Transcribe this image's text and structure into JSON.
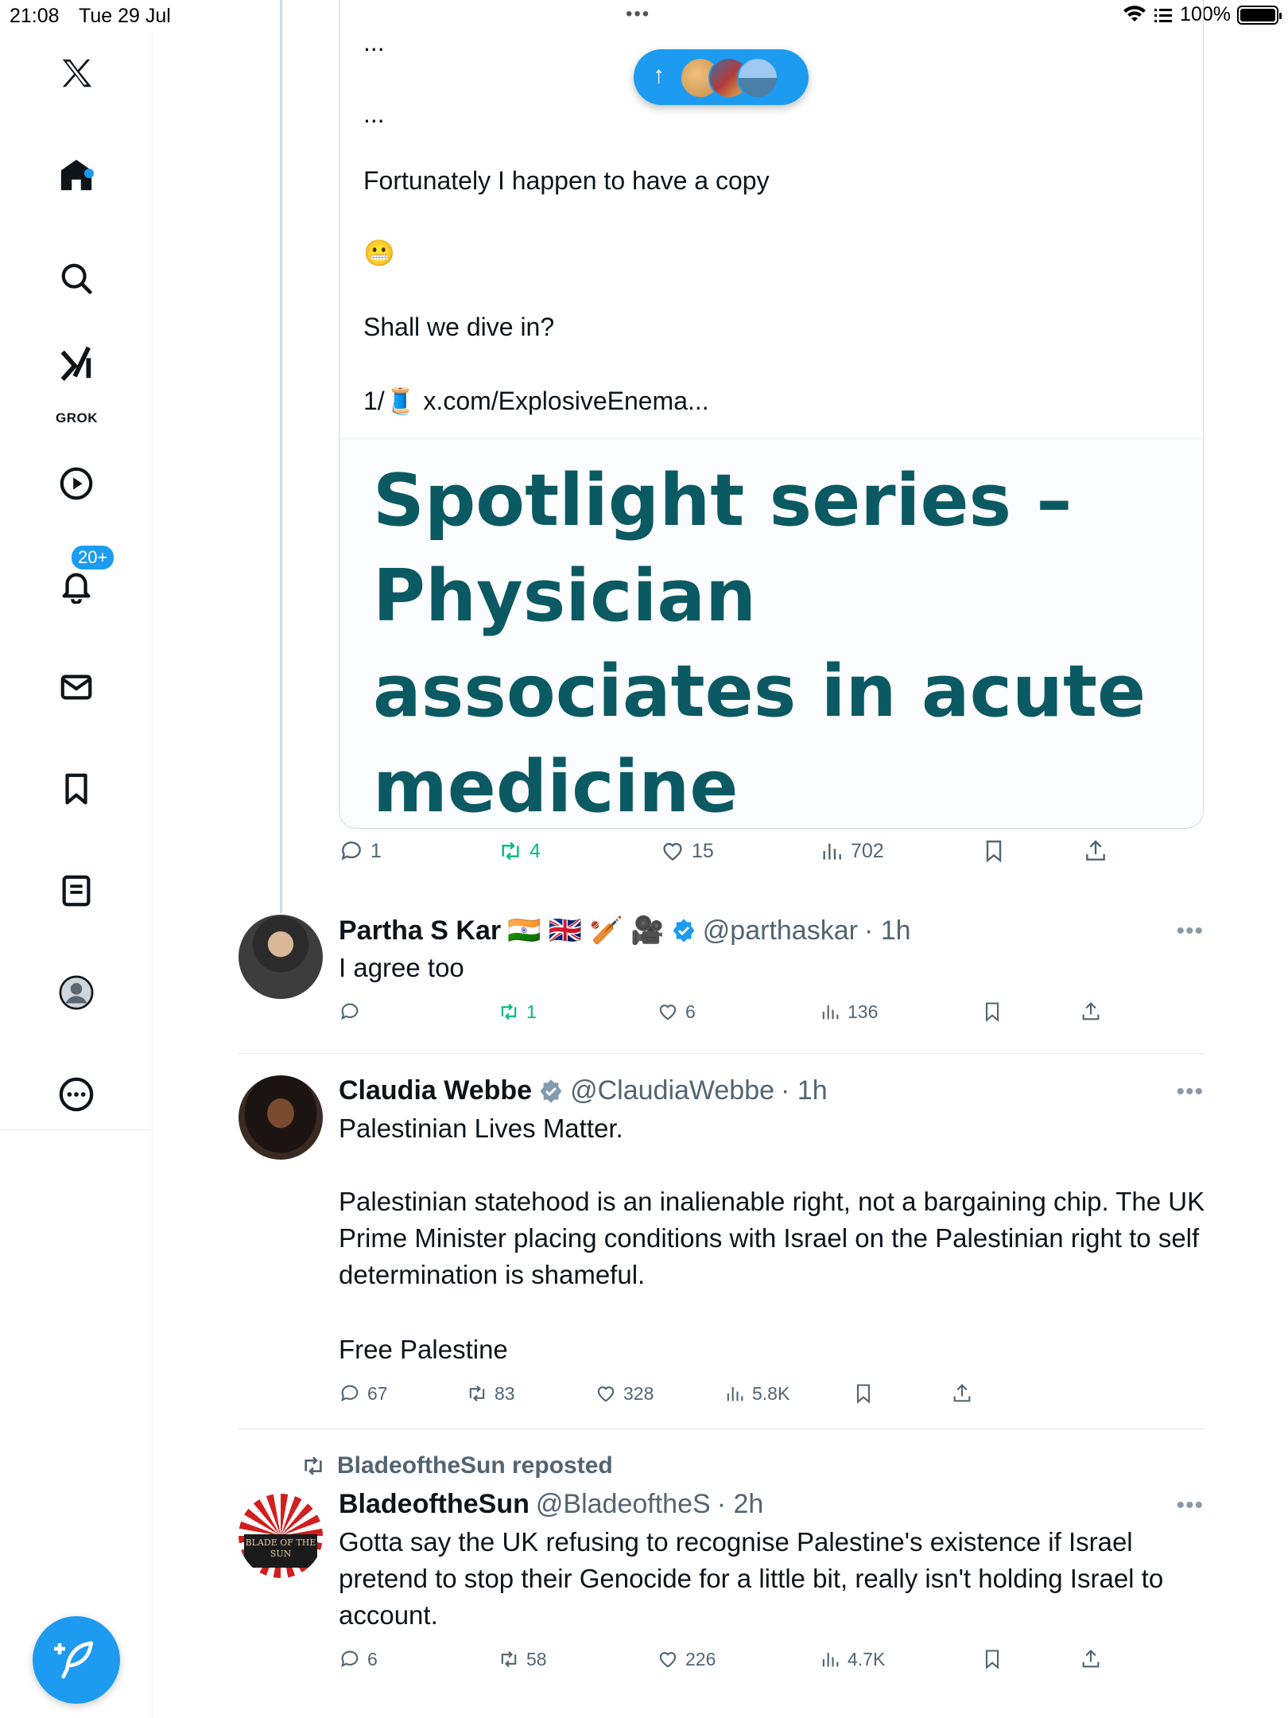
{
  "status_bar": {
    "time": "21:08",
    "date": "Tue 29 Jul",
    "multitask_dots": "•••",
    "battery": "100%"
  },
  "sidebar": {
    "grok_label": "GROK",
    "notifications_badge": "20+",
    "items": [
      "x-logo",
      "home",
      "search",
      "grok",
      "video",
      "notifications",
      "messages",
      "bookmarks",
      "lists",
      "profile",
      "more"
    ]
  },
  "quoted_post": {
    "ellipsis_1": "...",
    "ellipsis_2": "...",
    "line_copy": "Fortunately I happen to have a copy",
    "emoji": "😬",
    "line_dive": "Shall we dive in?",
    "thread_prefix": "1/",
    "thread_emoji": "🧵",
    "link": "x.com/ExplosiveEnema...",
    "image_headline": "Spotlight series – Physician associates in acute medicine",
    "stats": {
      "replies": "1",
      "reposts": "4",
      "likes": "15",
      "views": "702"
    }
  },
  "posts": [
    {
      "name": "Partha S Kar",
      "flags": "🇮🇳 🇬🇧 🏏 🎥",
      "handle": "@parthaskar",
      "time": "· 1h",
      "verified": "blue",
      "text": "I agree too",
      "stats": {
        "replies": "",
        "reposts": "1",
        "likes": "6",
        "views": "136"
      }
    },
    {
      "name": "Claudia Webbe",
      "handle": "@ClaudiaWebbe",
      "time": "· 1h",
      "verified": "grey",
      "text_1": "Palestinian Lives Matter.",
      "text_2": "Palestinian statehood is an inalienable right, not a bargaining chip. The UK Prime Minister placing conditions with Israel on the Palestinian right to self determination is shameful.",
      "text_3": "Free Palestine",
      "stats": {
        "replies": "67",
        "reposts": "83",
        "likes": "328",
        "views": "5.8K"
      }
    },
    {
      "repost_label": "BladeoftheSun reposted",
      "name": "BladeoftheSun",
      "handle": "@BladeoftheS",
      "time": "· 2h",
      "avatar_text": "BLADE OF THE SUN",
      "text": "Gotta say the UK refusing to recognise Palestine's existence if Israel pretend to stop their Genocide for a little bit, really isn't holding Israel to account.",
      "stats": {
        "replies": "6",
        "reposts": "58",
        "likes": "226",
        "views": "4.7K"
      }
    }
  ],
  "more_label": "•••",
  "colors": {
    "accent": "#1d9bf0",
    "repost_green": "#00ba7c",
    "secondary_text": "#536471",
    "headline_teal": "#0b5a63"
  }
}
